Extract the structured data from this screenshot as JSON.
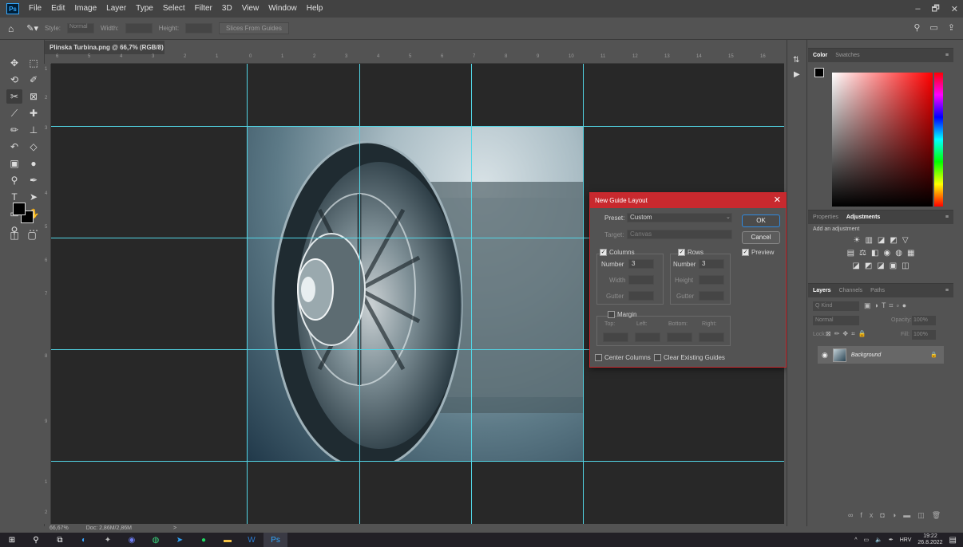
{
  "app": {
    "logo": "Ps"
  },
  "menu": [
    "File",
    "Edit",
    "Image",
    "Layer",
    "Type",
    "Select",
    "Filter",
    "3D",
    "View",
    "Window",
    "Help"
  ],
  "window_controls": [
    "–",
    "🗗",
    "✕"
  ],
  "options_bar": {
    "style_label": "Style:",
    "style_value": "Normal",
    "width_label": "Width:",
    "height_label": "Height:",
    "slices_button": "Slices From Guides"
  },
  "document": {
    "tab_title": "Plinska Turbina.png @ 66,7% (RGB/8)",
    "tab_close": "×",
    "status_zoom": "66,67%",
    "status_doc": "Doc: 2,86M/2,86M",
    "status_arrow": ">"
  },
  "ruler_h_labels": [
    "6",
    "5",
    "4",
    "3",
    "2",
    "1",
    "0",
    "1",
    "2",
    "3",
    "4",
    "5",
    "6",
    "7",
    "8",
    "9",
    "10",
    "11",
    "12",
    "13",
    "14",
    "15",
    "16"
  ],
  "ruler_v_labels": [
    "1",
    "2",
    "3",
    "4",
    "5",
    "6",
    "7",
    "8",
    "9",
    "1",
    "2"
  ],
  "dialog": {
    "title": "New Guide Layout",
    "close": "✕",
    "preset_label": "Preset:",
    "preset_value": "Custom",
    "target_label": "Target:",
    "target_value": "Canvas",
    "columns_label": "Columns",
    "columns_checked": true,
    "rows_label": "Rows",
    "rows_checked": true,
    "number_label": "Number",
    "columns_number": "3",
    "rows_number": "3",
    "width_label": "Width",
    "height_label": "Height",
    "gutter_label": "Gutter",
    "margin_label": "Margin",
    "margin_checked": false,
    "top_label": "Top:",
    "left_label": "Left:",
    "bottom_label": "Bottom:",
    "right_label": "Right:",
    "center_columns_label": "Center Columns",
    "clear_guides_label": "Clear Existing Guides",
    "ok_button": "OK",
    "cancel_button": "Cancel",
    "preview_label": "Preview",
    "preview_checked": true
  },
  "color_panel": {
    "tabs": [
      "Color",
      "Swatches"
    ]
  },
  "adjustments_panel": {
    "tabs": [
      "Properties",
      "Adjustments"
    ],
    "hint": "Add an adjustment"
  },
  "layers_panel": {
    "tabs": [
      "Layers",
      "Channels",
      "Paths"
    ],
    "kind_label": "Q Kind",
    "blend_mode": "Normal",
    "opacity_label": "Opacity:",
    "opacity_value": "100%",
    "lock_label": "Lock:",
    "fill_label": "Fill:",
    "fill_value": "100%",
    "layer_name": "Background"
  },
  "taskbar": {
    "language": "HRV",
    "time": "19:22",
    "date": "26.8.2022"
  },
  "colors": {
    "dialog_accent": "#c8292e",
    "guide": "#52d6e6",
    "canvas_bg": "#282828"
  }
}
